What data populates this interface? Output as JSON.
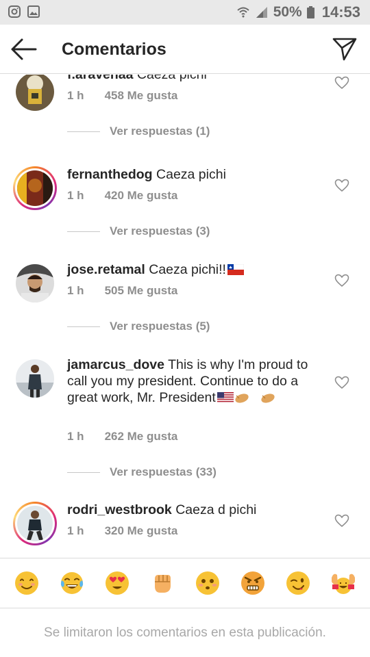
{
  "status_bar": {
    "battery": "50%",
    "time": "14:53"
  },
  "header": {
    "title": "Comentarios"
  },
  "comments": [
    {
      "username": "f.aravenaa",
      "text": "Caeza pichi",
      "time": "1 h",
      "likes": "458 Me gusta",
      "replies": "Ver respuestas (1)"
    },
    {
      "username": "fernanthedog",
      "text": "Caeza pichi",
      "time": "1 h",
      "likes": "420 Me gusta",
      "replies": "Ver respuestas (3)"
    },
    {
      "username": "jose.retamal",
      "text": "Caeza pichi!!",
      "time": "1 h",
      "likes": "505 Me gusta",
      "replies": "Ver respuestas (5)"
    },
    {
      "username": "jamarcus_dove",
      "text": "This is why I'm proud to call you my president. Continue to do a great work, Mr. President",
      "time": "1 h",
      "likes": "262 Me gusta",
      "replies": "Ver respuestas (33)"
    },
    {
      "username": "rodri_westbrook",
      "text": "Caeza d pichi",
      "time": "1 h",
      "likes": "320 Me gusta"
    }
  ],
  "emoji_bar": [
    "smiling-face",
    "tears-of-joy",
    "heart-eyes",
    "raised-fist",
    "flushed-face",
    "angry-face",
    "winking-face",
    "raising-hands"
  ],
  "footer": {
    "notice": "Se limitaron los comentarios en esta publicación."
  },
  "colors": {
    "accent_ring": "#dd2a7b",
    "meta_gray": "#8e8e8e",
    "text": "#262626"
  }
}
